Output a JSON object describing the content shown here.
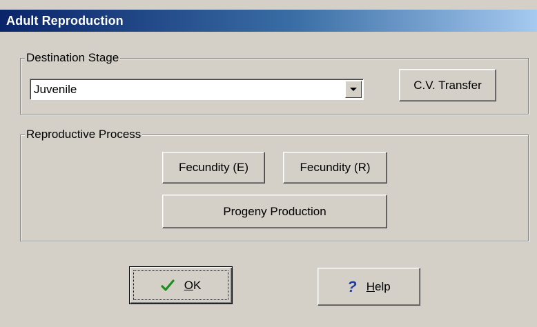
{
  "window": {
    "title": "Adult Reproduction"
  },
  "destination": {
    "group_label": "Destination Stage",
    "selected_value": "Juvenile",
    "cv_transfer_label": "C.V. Transfer"
  },
  "reproductive": {
    "group_label": "Reproductive Process",
    "fecundity_e_label": "Fecundity (E)",
    "fecundity_r_label": "Fecundity (R)",
    "progeny_label": "Progeny Production"
  },
  "footer": {
    "ok_accel": "O",
    "ok_rest": "K",
    "help_accel": "H",
    "help_rest": "elp"
  },
  "icons": {
    "ok": "checkmark-icon",
    "help": "question-icon",
    "check_color": "#1e8c1e",
    "help_color": "#1f3fa8"
  }
}
